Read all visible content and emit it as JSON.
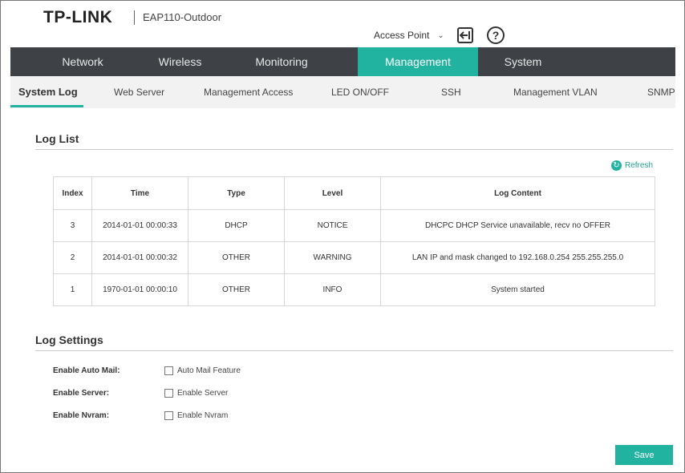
{
  "header": {
    "logo": "TP-LINK",
    "model": "EAP110-Outdoor",
    "mode": "Access Point"
  },
  "main_nav": [
    {
      "label": "Network",
      "active": false
    },
    {
      "label": "Wireless",
      "active": false
    },
    {
      "label": "Monitoring",
      "active": false
    },
    {
      "label": "Management",
      "active": true
    },
    {
      "label": "System",
      "active": false
    }
  ],
  "sub_nav": [
    {
      "label": "System Log",
      "active": true
    },
    {
      "label": "Web Server",
      "active": false
    },
    {
      "label": "Management Access",
      "active": false
    },
    {
      "label": "LED ON/OFF",
      "active": false
    },
    {
      "label": "SSH",
      "active": false
    },
    {
      "label": "Management VLAN",
      "active": false
    },
    {
      "label": "SNMP",
      "active": false
    }
  ],
  "log_list": {
    "title": "Log List",
    "refresh_label": "Refresh",
    "columns": [
      "Index",
      "Time",
      "Type",
      "Level",
      "Log Content"
    ],
    "rows": [
      {
        "index": "3",
        "time": "2014-01-01 00:00:33",
        "type": "DHCP",
        "level": "NOTICE",
        "content": "DHCPC DHCP Service unavailable, recv no OFFER"
      },
      {
        "index": "2",
        "time": "2014-01-01 00:00:32",
        "type": "OTHER",
        "level": "WARNING",
        "content": "LAN IP and mask changed to 192.168.0.254 255.255.255.0"
      },
      {
        "index": "1",
        "time": "1970-01-01 00:00:10",
        "type": "OTHER",
        "level": "INFO",
        "content": "System started"
      }
    ]
  },
  "log_settings": {
    "title": "Log Settings",
    "items": [
      {
        "label": "Enable Auto Mail:",
        "option": "Auto Mail Feature",
        "checked": false
      },
      {
        "label": "Enable Server:",
        "option": "Enable Server",
        "checked": false
      },
      {
        "label": "Enable Nvram:",
        "option": "Enable Nvram",
        "checked": false
      }
    ],
    "save_label": "Save"
  },
  "colors": {
    "accent": "#22b3a0",
    "nav_bg": "#3e4246",
    "subnav_bg": "#f2f2f2"
  }
}
